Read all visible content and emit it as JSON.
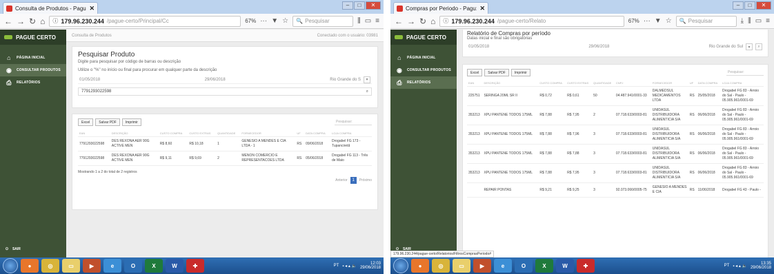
{
  "colors": {
    "sidebar": "#3e5236",
    "brand": "#2d3e28",
    "accent": "#3a6ebc",
    "taskbar": "#1c4f8d"
  },
  "left": {
    "tab_title": "Consulta de Produtos - Pagu:",
    "url_host": "179.96.230.244",
    "url_path": "/pague-certo/Principal/Cc",
    "zoom": "67%",
    "search_placeholder": "Pesquisar",
    "brand": "PAGUE CERTO",
    "sidebar": [
      {
        "label": "PÁGINA INICIAL",
        "icon": "home-icon"
      },
      {
        "label": "CONSULTAR PRODUTOS",
        "icon": "globe-icon"
      },
      {
        "label": "RELATÓRIOS",
        "icon": "printer-icon"
      }
    ],
    "sidebar_exit": "SAIR",
    "breadcrumb": "Consulta de Produtos",
    "connected_user": "Conectado com o usuário: 03981",
    "panel_title": "Pesquisar Produto",
    "subtitle": "Digite para pesquisar por código de barras ou descrição",
    "hint": "Utilize o \"%\" no início ou final para procurar em qualquer parte da descrição",
    "date_from": "01/05/2018",
    "date_to": "29/06/2018",
    "state": "Rio Grande do S",
    "query_value": "7791293022598",
    "buttons": [
      "Excel",
      "Salvar PDF",
      "Imprimir"
    ],
    "table_search": "Pesquisar:",
    "columns": [
      "EAN",
      "DESCRIÇÃO",
      "CUSTO COMPRA",
      "CUSTO EXTRAS",
      "QUANTIDADE",
      "FORNECEDOR",
      "UF",
      "DATA COMPRA",
      "LOJA COMPRA"
    ],
    "rows": [
      [
        "7791293022598",
        "DES REXONA AER 90G ACTIVE MEN",
        "R$ 8,60",
        "R$ 10,18",
        "1",
        "GENESIO A MENDES E CIA LTDA - 1",
        "RS",
        "09/06/2018",
        "Drogabel FG 173 - Tupanciretã"
      ],
      [
        "7791293022598",
        "DES REXONA AER 90G ACTIVE MEN",
        "R$ 9,11",
        "R$ 9,69",
        "2",
        "MENON COMERCIO E REPRESENTACOES LTDA",
        "RS",
        "05/06/2018",
        "Drogabel FG 113 - Três de Maio"
      ]
    ],
    "records_info": "Mostrando 1 a 2 do total de 2 registros",
    "pager": {
      "prev": "Anterior",
      "current": "1",
      "next": "Próximo"
    },
    "clock": "12:03",
    "date": "29/06/2018",
    "tray_lang": "PT"
  },
  "right": {
    "tab_title": "Compras por Periodo - Pagu:",
    "url_host": "179.96.230.244",
    "url_path": "/pague-certo/Relato",
    "zoom": "67%",
    "search_placeholder": "Pesquisar",
    "brand": "PAGUE CERTO",
    "sidebar": [
      {
        "label": "PÁGINA INICIAL",
        "icon": "home-icon"
      },
      {
        "label": "CONSULTAR PRODUTOS",
        "icon": "globe-icon"
      },
      {
        "label": "RELATÓRIOS",
        "icon": "printer-icon"
      }
    ],
    "sidebar_exit": "SAIR",
    "panel_title": "Relatório de Compras por período",
    "subtitle": "Datas inicial e final são obrigatórias",
    "date_from": "01/05/2018",
    "date_to": "29/06/2018",
    "state": "Rio Grande do Sul",
    "buttons": [
      "Excel",
      "Salvar PDF",
      "Imprimir"
    ],
    "table_search": "Pesquisar:",
    "columns": [
      "EAN",
      "DESCRIÇÃO",
      "CUSTO COMPRA",
      "CUSTO EXTRAS",
      "QUANTIDADE",
      "CNPJ",
      "FORNECEDOR",
      "UF",
      "DATA COMPRA",
      "LOJA COMPRA"
    ],
    "rows": [
      [
        "225751",
        "SERINGA 20ML SR II",
        "R$ 0,72",
        "R$ 0,61",
        "50",
        "04.487.941/0001-33",
        "DALMEDSUL MEDICAMENTOS LTDA",
        "RS",
        "25/05/2018",
        "Drogabel FG 83 - Arroio do Sal - Paulo - 05.905.961/0001-69"
      ],
      [
        "353213",
        "XPU PANTENE TODOS 175ML",
        "R$ 7,88",
        "R$ 7,95",
        "2",
        "07.718.633/0003-81",
        "UNIDASUL DISTRIBUIDORA ALIMENTICIA S/A",
        "RS",
        "06/06/2018",
        "Drogabel FG 83 - Arroio do Sal - Paulo - 05.905.961/0001-69"
      ],
      [
        "353213",
        "XPU PANTENE TODOS 175ML",
        "R$ 7,88",
        "R$ 7,96",
        "3",
        "07.718.633/0003-81",
        "UNIDASUL DISTRIBUIDORA ALIMENTICIA S/A",
        "RS",
        "06/06/2018",
        "Drogabel FG 83 - Arroio do Sal - Paulo - 05.905.961/0001-69"
      ],
      [
        "353213",
        "XPU PANTENE TODOS 175ML",
        "R$ 7,88",
        "R$ 7,88",
        "3",
        "07.718.633/0003-81",
        "UNIDASUL DISTRIBUIDORA ALIMENTICIA S/A",
        "RS",
        "06/06/2018",
        "Drogabel FG 83 - Arroio do Sal - Paulo - 05.905.961/0001-69"
      ],
      [
        "353213",
        "XPU PANTENE TODOS 175ML",
        "R$ 7,88",
        "R$ 7,95",
        "3",
        "07.718.633/0003-81",
        "UNIDASUL DISTRIBUIDORA ALIMENTICIA S/A",
        "RS",
        "06/06/2018",
        "Drogabel FG 83 - Arroio do Sal - Paulo - 05.905.961/0001-69"
      ],
      [
        "",
        "REPAIR PONTAS",
        "R$ 9,21",
        "R$ 9,25",
        "3",
        "92.073.066/0005-75",
        "GENESIO A MENDES E CIA",
        "RS",
        "11/06/2018",
        "Drogabel FG 43 - Paulo -"
      ]
    ],
    "status_url": "179.96.230.244/pague-certo/Relatorios/FiltrosComprasPeriodo#",
    "clock": "13:35",
    "date": "29/06/2018",
    "tray_lang": "PT"
  }
}
